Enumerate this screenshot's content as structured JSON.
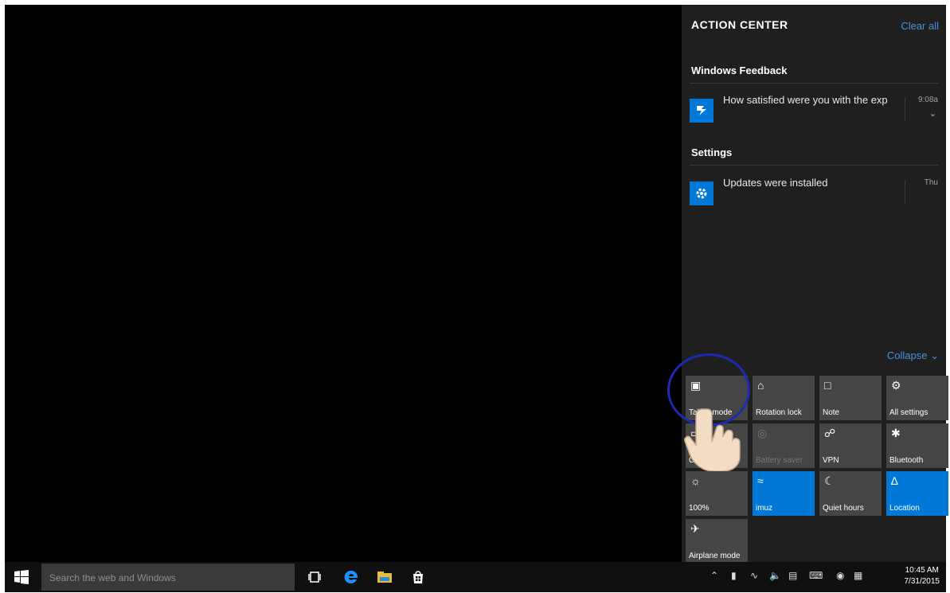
{
  "action_center": {
    "title": "ACTION CENTER",
    "clear_all": "Clear all",
    "collapse": "Collapse",
    "groups": [
      {
        "name": "Windows Feedback",
        "notification": {
          "text": "How satisfied were you with the exp",
          "time": "9:08a"
        }
      },
      {
        "name": "Settings",
        "notification": {
          "text": "Updates were installed",
          "time": "Thu"
        }
      }
    ],
    "tiles": [
      {
        "label": "Tablet mode",
        "icon": "tablet-mode-icon",
        "active": false,
        "dim": false
      },
      {
        "label": "Rotation lock",
        "icon": "rotation-lock-icon",
        "active": false,
        "dim": false
      },
      {
        "label": "Note",
        "icon": "note-icon",
        "active": false,
        "dim": false
      },
      {
        "label": "All settings",
        "icon": "settings-icon",
        "active": false,
        "dim": false
      },
      {
        "label": "Connect",
        "icon": "connect-icon",
        "active": false,
        "dim": false
      },
      {
        "label": "Battery saver",
        "icon": "battery-saver-icon",
        "active": false,
        "dim": true
      },
      {
        "label": "VPN",
        "icon": "vpn-icon",
        "active": false,
        "dim": false
      },
      {
        "label": "Bluetooth",
        "icon": "bluetooth-icon",
        "active": false,
        "dim": false
      },
      {
        "label": "100%",
        "icon": "brightness-icon",
        "active": false,
        "dim": false
      },
      {
        "label": "imuz",
        "icon": "wifi-icon",
        "active": true,
        "dim": false
      },
      {
        "label": "Quiet hours",
        "icon": "moon-icon",
        "active": false,
        "dim": false
      },
      {
        "label": "Location",
        "icon": "location-icon",
        "active": true,
        "dim": false
      },
      {
        "label": "Airplane mode",
        "icon": "airplane-icon",
        "active": false,
        "dim": false
      }
    ]
  },
  "taskbar": {
    "search_placeholder": "Search the web and Windows",
    "time": "10:45 AM",
    "date": "7/31/2015"
  },
  "colors": {
    "accent": "#0078d7",
    "link": "#4a8fdc",
    "annotation_ring": "#1e2bb0"
  }
}
